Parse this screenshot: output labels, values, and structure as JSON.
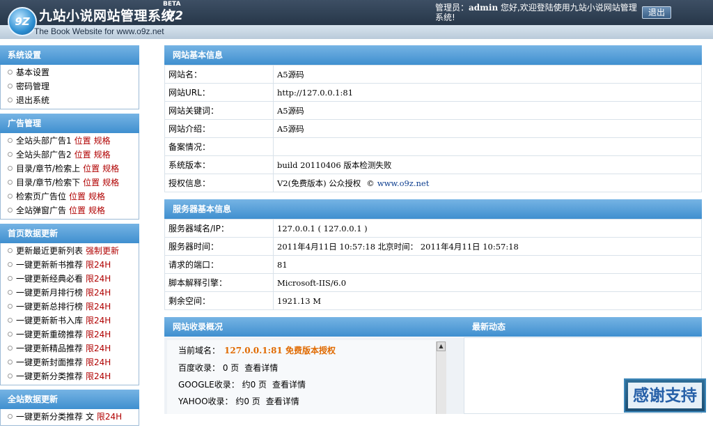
{
  "header": {
    "logo_badge": "9Z",
    "title": "九站小说网站管理系统",
    "beta": "BETA",
    "version": "V2",
    "subtitle": "The Book Website for www.o9z.net",
    "admin_label": "管理员：",
    "admin_name": "admin",
    "welcome": " 您好,欢迎登陆使用九站小说网站管理系统!",
    "logout_label": "退出"
  },
  "sidebar": {
    "panels": [
      {
        "title": "系统设置",
        "items": [
          {
            "label": "基本设置"
          },
          {
            "label": "密码管理"
          },
          {
            "label": "退出系统"
          }
        ]
      },
      {
        "title": "广告管理",
        "items": [
          {
            "label": "全站头部广告1",
            "links": [
              "位置",
              "规格"
            ]
          },
          {
            "label": "全站头部广告2",
            "links": [
              "位置",
              "规格"
            ]
          },
          {
            "label": "目录/章节/检索上",
            "links": [
              "位置",
              "规格"
            ]
          },
          {
            "label": "目录/章节/检索下",
            "links": [
              "位置",
              "规格"
            ]
          },
          {
            "label": "检索页广告位",
            "links": [
              "位置",
              "规格"
            ]
          },
          {
            "label": "全站弹窗广告",
            "links": [
              "位置",
              "规格"
            ]
          }
        ]
      },
      {
        "title": "首页数据更新",
        "items": [
          {
            "label": "更新最近更新列表",
            "links": [
              "强制更新"
            ]
          },
          {
            "label": "一键更新新书推荐",
            "links": [
              "限24H"
            ]
          },
          {
            "label": "一键更新经典必看",
            "links": [
              "限24H"
            ]
          },
          {
            "label": "一键更新月排行榜",
            "links": [
              "限24H"
            ]
          },
          {
            "label": "一键更新总排行榜",
            "links": [
              "限24H"
            ]
          },
          {
            "label": "一键更新新书入库",
            "links": [
              "限24H"
            ]
          },
          {
            "label": "一键更新重磅推荐",
            "links": [
              "限24H"
            ]
          },
          {
            "label": "一键更新精品推荐",
            "links": [
              "限24H"
            ]
          },
          {
            "label": "一键更新封面推荐",
            "links": [
              "限24H"
            ]
          },
          {
            "label": "一键更新分类推荐",
            "links": [
              "限24H"
            ]
          }
        ]
      },
      {
        "title": "全站数据更新",
        "items": [
          {
            "label": "一键更新分类推荐 文",
            "links": [
              "限24H"
            ]
          }
        ]
      }
    ]
  },
  "site_info": {
    "title": "网站基本信息",
    "rows": [
      {
        "key": "网站名：",
        "value": "A5源码"
      },
      {
        "key": "网站URL：",
        "value": "http://127.0.0.1:81"
      },
      {
        "key": "网站关键词：",
        "value": "A5源码"
      },
      {
        "key": "网站介绍：",
        "value": "A5源码"
      },
      {
        "key": "备案情况：",
        "value": ""
      },
      {
        "key": "系统版本：",
        "value": "build 20110406 版本检测失败"
      },
      {
        "key": "授权信息：",
        "value": "V2(免费版本) 公众授权",
        "copyright": "©",
        "link": "www.o9z.net"
      }
    ]
  },
  "server_info": {
    "title": "服务器基本信息",
    "rows": [
      {
        "key": "服务器域名/IP：",
        "value": "127.0.0.1 ( 127.0.0.1 )"
      },
      {
        "key": "服务器时间：",
        "value": "2011年4月11日  10:57:18  北京时间：  2011年4月11日  10:57:18"
      },
      {
        "key": "请求的端口：",
        "value": "81"
      },
      {
        "key": "脚本解释引擎：",
        "value": "Microsoft-IIS/6.0"
      },
      {
        "key": "剩余空间：",
        "value": "1921.13 M"
      }
    ]
  },
  "collect": {
    "title": "网站收录概况",
    "current_label": "当前域名：",
    "current_value": "127.0.0.1:81 免费版本授权",
    "lines": [
      {
        "label": "百度收录：  0 页",
        "link": "查看详情"
      },
      {
        "label": "GOOGLE收录：  约0 页",
        "link": "查看详情"
      },
      {
        "label": "YAHOO收录：  约0 页",
        "link": "查看详情"
      }
    ]
  },
  "news": {
    "title": "最新动态"
  },
  "thanks": {
    "label": "感谢支持"
  },
  "colors": {
    "header_dark": "#2a3a4d",
    "section_blue": "#4f9ad6",
    "accent_red": "#b00000",
    "accent_orange": "#e06a00"
  }
}
